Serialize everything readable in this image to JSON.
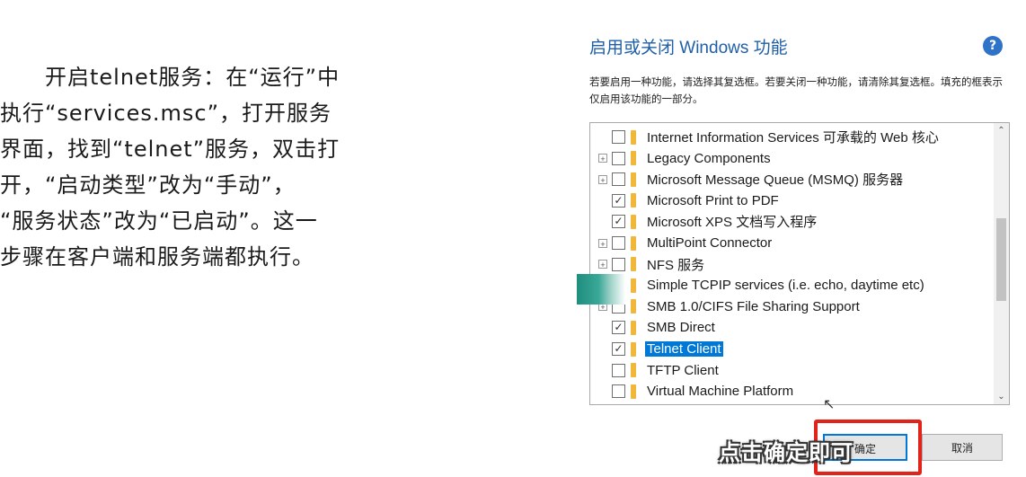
{
  "slide": {
    "lines": [
      "开启telnet服务：在“运行”中",
      "执行“services.msc”，打开服务",
      "界面，找到“telnet”服务，双击打",
      "开，“启动类型”改为“手动”，",
      "“服务状态”改为“已启动”。这一",
      "步骤在客户端和服务端都执行。"
    ]
  },
  "dialog": {
    "title": "启用或关闭 Windows 功能",
    "help_icon": "?",
    "description": "若要启用一种功能，请选择其复选框。若要关闭一种功能，请清除其复选框。填充的框表示仅启用该功能的一部分。",
    "features": [
      {
        "label": "Internet Information Services 可承载的 Web 核心",
        "checked": false,
        "expandable": false
      },
      {
        "label": "Legacy Components",
        "checked": false,
        "expandable": true
      },
      {
        "label": "Microsoft Message Queue (MSMQ) 服务器",
        "checked": false,
        "expandable": true
      },
      {
        "label": "Microsoft Print to PDF",
        "checked": true,
        "expandable": false
      },
      {
        "label": "Microsoft XPS 文档写入程序",
        "checked": true,
        "expandable": false
      },
      {
        "label": "MultiPoint Connector",
        "checked": false,
        "expandable": true
      },
      {
        "label": "NFS 服务",
        "checked": false,
        "expandable": true
      },
      {
        "label": "Simple TCPIP services (i.e. echo, daytime etc)",
        "checked": false,
        "expandable": false
      },
      {
        "label": "SMB 1.0/CIFS File Sharing Support",
        "checked": false,
        "expandable": true
      },
      {
        "label": "SMB Direct",
        "checked": true,
        "expandable": false
      },
      {
        "label": "Telnet Client",
        "checked": true,
        "expandable": false,
        "selected": true
      },
      {
        "label": "TFTP Client",
        "checked": false,
        "expandable": false
      },
      {
        "label": "Virtual Machine Platform",
        "checked": false,
        "expandable": false
      }
    ],
    "ok_label": "确定",
    "cancel_label": "取消"
  },
  "subtitle": "点击确定即可",
  "colors": {
    "title": "#1f5fa8",
    "selection": "#0078d7",
    "highlight_box": "#e2231a",
    "marker": "#1e8e7e"
  }
}
